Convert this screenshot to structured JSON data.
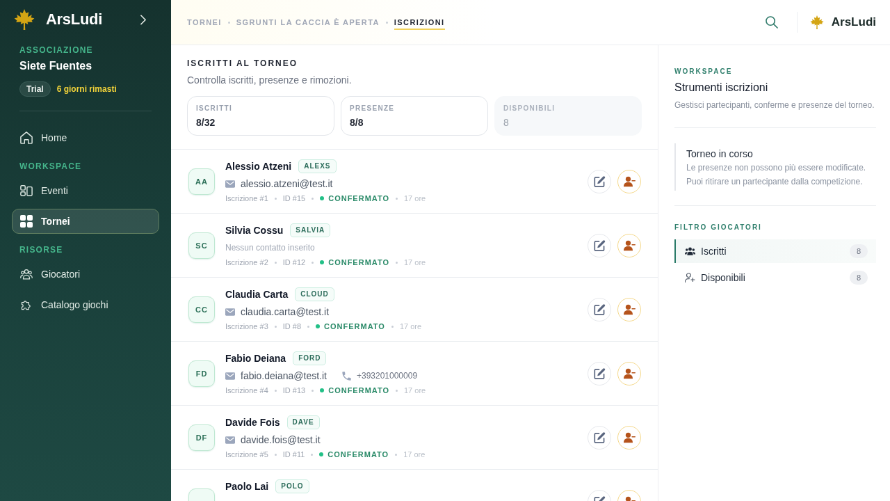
{
  "sidebar": {
    "brand": "ArsLudi",
    "org_label": "ASSOCIAZIONE",
    "org_name": "Siete Fuentes",
    "plan": "Trial",
    "plan_note": "6 giorni rimasti",
    "nav": [
      {
        "items": [
          {
            "label": "Home",
            "selected": false
          }
        ]
      },
      {
        "title": "WORKSPACE",
        "items": [
          {
            "label": "Eventi",
            "selected": false
          },
          {
            "label": "Tornei",
            "selected": true
          }
        ]
      },
      {
        "title": "RISORSE",
        "items": [
          {
            "label": "Giocatori",
            "selected": false
          },
          {
            "label": "Catalogo giochi",
            "selected": false
          }
        ]
      }
    ]
  },
  "header": {
    "breadcrumb": [
      {
        "label": "TORNEI",
        "selected": false
      },
      {
        "label": "SGRUNTI LA CACCIA È APERTA",
        "selected": false
      },
      {
        "label": "ISCRIZIONI",
        "selected": true
      }
    ],
    "brand": "ArsLudi"
  },
  "main": {
    "title": "ISCRITTI AL TORNEO",
    "subtitle": "Controlla iscritti, presenze e rimozioni.",
    "stats": [
      {
        "label": "ISCRITTI",
        "value": "8/32",
        "disabled": false
      },
      {
        "label": "PRESENZE",
        "value": "8/8",
        "disabled": false
      },
      {
        "label": "DISPONIBILI",
        "value": "8",
        "disabled": true
      }
    ],
    "players": [
      {
        "initials": "AA",
        "name": "Alessio Atzeni",
        "nickname": "ALEXS",
        "contacts": [
          {
            "kind": "email",
            "text": "alessio.atzeni@test.it"
          }
        ],
        "registration": "Iscrizione #1",
        "id": "ID #15",
        "status": "CONFERMATO",
        "time": "17 ore"
      },
      {
        "initials": "SC",
        "name": "Silvia Cossu",
        "nickname": "SALVIA",
        "note": "Nessun contatto inserito",
        "registration": "Iscrizione #2",
        "id": "ID #12",
        "status": "CONFERMATO",
        "time": "17 ore"
      },
      {
        "initials": "CC",
        "name": "Claudia Carta",
        "nickname": "CLOUD",
        "contacts": [
          {
            "kind": "email",
            "text": "claudia.carta@test.it"
          }
        ],
        "registration": "Iscrizione #3",
        "id": "ID #8",
        "status": "CONFERMATO",
        "time": "17 ore"
      },
      {
        "initials": "FD",
        "name": "Fabio Deiana",
        "nickname": "FORD",
        "contacts": [
          {
            "kind": "email",
            "text": "fabio.deiana@test.it"
          },
          {
            "kind": "phone",
            "text": "+393201000009"
          }
        ],
        "registration": "Iscrizione #4",
        "id": "ID #13",
        "status": "CONFERMATO",
        "time": "17 ore"
      },
      {
        "initials": "DF",
        "name": "Davide Fois",
        "nickname": "DAVE",
        "contacts": [
          {
            "kind": "email",
            "text": "davide.fois@test.it"
          }
        ],
        "registration": "Iscrizione #5",
        "id": "ID #11",
        "status": "CONFERMATO",
        "time": "17 ore"
      },
      {
        "name": "Paolo Lai",
        "nickname": "POLO"
      }
    ]
  },
  "panel": {
    "label": "WORKSPACE",
    "title": "Strumenti iscrizioni",
    "description": "Gestisci partecipanti, conferme e presenze del torneo.",
    "notice": {
      "title": "Torneo in corso",
      "lines": [
        "Le presenze non possono più essere modificate.",
        "Puoi ritirare un partecipante dalla competizione."
      ]
    },
    "filter_title": "FILTRO GIOCATORI",
    "filters": [
      {
        "label": "Iscritti",
        "count": "8",
        "selected": true
      },
      {
        "label": "Disponibili",
        "count": "8",
        "selected": false
      }
    ]
  }
}
